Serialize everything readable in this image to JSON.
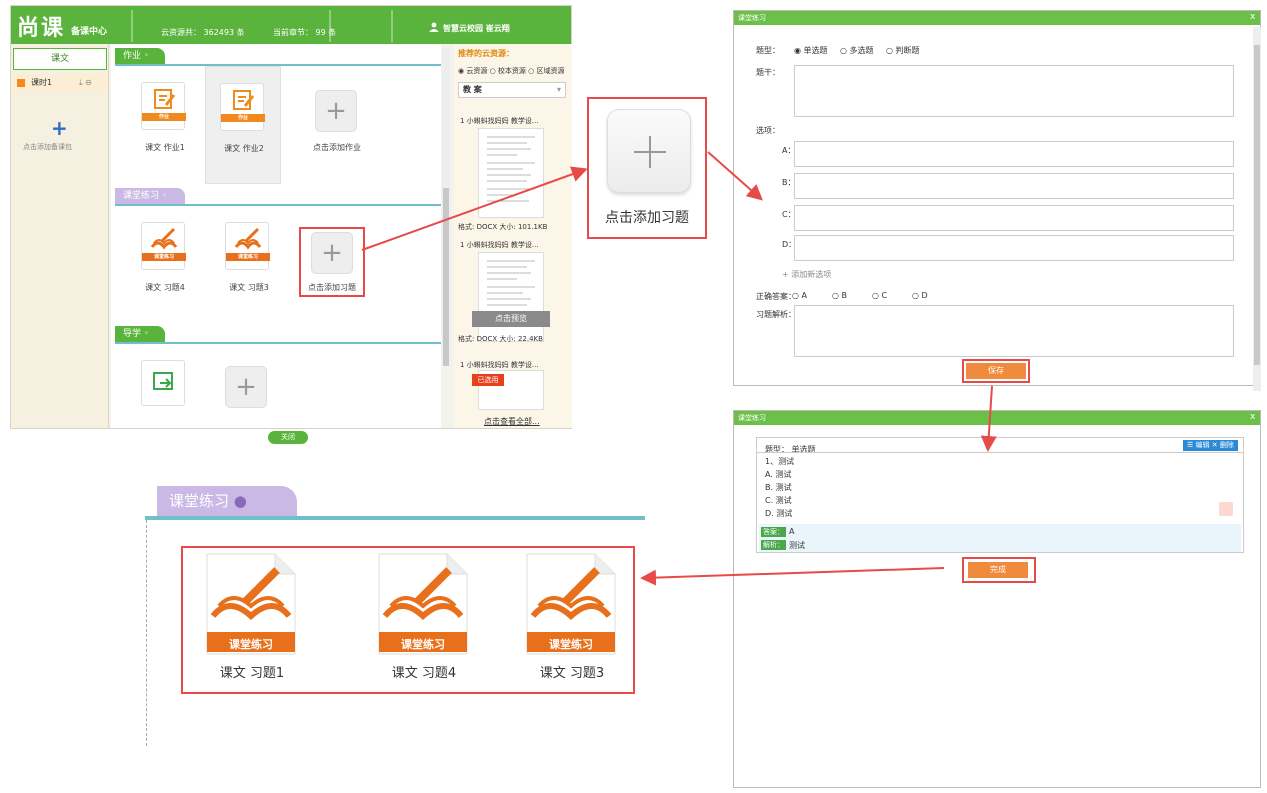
{
  "main": {
    "logo": "尚课",
    "logo_sub": "备课中心",
    "stat_cloud": "云资源共： 362493 条",
    "stat_chapter": "当前章节： 99 条",
    "user": "智慧云校园 崔云翔",
    "left_tab": "课文",
    "lesson_item": "课时1",
    "lesson_ops": "⤓ ⊖",
    "add_lesson_label": "点击添加备课包",
    "section_homework": "作业",
    "section_practice": "课堂练习",
    "section_guide": "导学",
    "homework_cards": [
      "课文 作业1",
      "课文 作业2"
    ],
    "add_homework": "点击添加作业",
    "practice_cards": [
      "课文 习题4",
      "课文 习题3"
    ],
    "add_practice": "点击添加习题",
    "band_homework": "作业",
    "band_practice": "课堂练习",
    "close": "关闭"
  },
  "resources": {
    "title": "推荐的云资源：",
    "radio_options": [
      "云资源",
      "校本资源",
      "区域资源"
    ],
    "select_value": "教 案",
    "items": [
      {
        "title": "1 小蝌蚪找妈妈 教学设...",
        "meta": "格式: DOCX  大小: 101.1KB"
      },
      {
        "title": "1 小蝌蚪找妈妈 教学设...",
        "meta": "格式: DOCX  大小: 22.4KB"
      },
      {
        "title": "1 小蝌蚪找妈妈 教学设...",
        "meta": ""
      }
    ],
    "preview": "点击预览",
    "used": "已选用",
    "see_all": "点击查看全部..."
  },
  "bigadd": {
    "label": "点击添加习题"
  },
  "dialog_edit": {
    "title": "课堂练习",
    "close": "x",
    "type_label": "题型：",
    "type_options": [
      "单选题",
      "多选题",
      "判断题"
    ],
    "stem_label": "题干：",
    "options_label": "选项：",
    "option_letters": [
      "A：",
      "B：",
      "C：",
      "D："
    ],
    "add_option": "+ 添加新选项",
    "answer_label": "正确答案：",
    "answer_options": [
      "A",
      "B",
      "C",
      "D"
    ],
    "analysis_label": "习题解析：",
    "save": "保存"
  },
  "dialog_result": {
    "title": "课堂练习",
    "close": "x",
    "type_line": "题型： 单选题",
    "edit_bar": "☰ 编辑  ✕ 删除",
    "question": "1、测试",
    "options": [
      "A. 测试",
      "B. 测试",
      "C. 测试",
      "D. 测试"
    ],
    "answer_tag": "答案：",
    "answer_value": "A",
    "analysis_tag": "解析：",
    "analysis_value": "测试",
    "done": "完成"
  },
  "zoom": {
    "section": "课堂练习",
    "cards": [
      "课文 习题1",
      "课文 习题4",
      "课文 习题3"
    ],
    "band": "课堂练习"
  },
  "colors": {
    "green": "#5ab33c",
    "orange": "#f08a1c",
    "red": "#e84a4a",
    "purple": "#c9b9e4",
    "teal": "#70c0cc"
  }
}
